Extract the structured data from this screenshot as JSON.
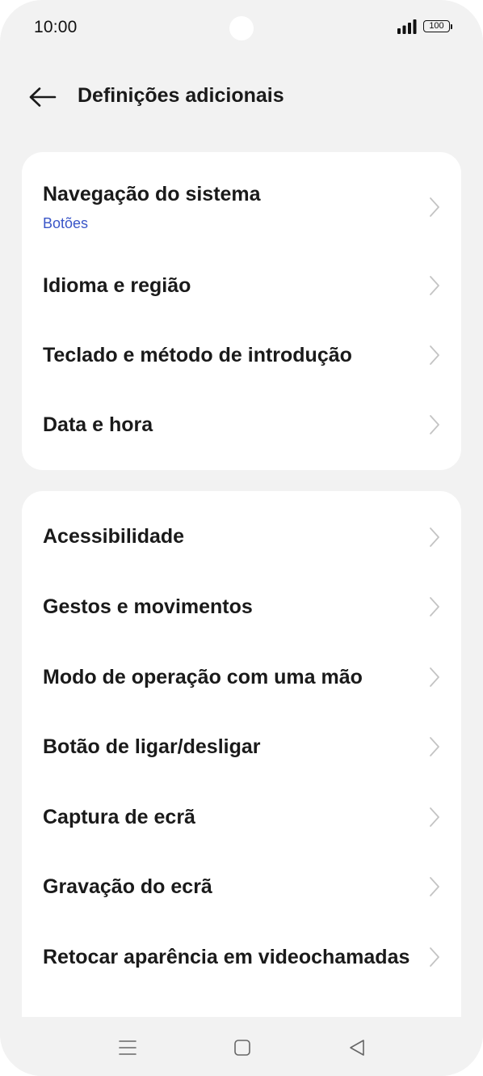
{
  "status_bar": {
    "time": "10:00",
    "battery": "100",
    "icons": [
      "signal-icon",
      "battery-icon"
    ]
  },
  "header": {
    "title": "Definições adicionais",
    "back_icon": "arrow-left-icon"
  },
  "group1": [
    {
      "label": "Navegação do sistema",
      "sub": "Botões"
    },
    {
      "label": "Idioma e região"
    },
    {
      "label": "Teclado e método de introdução"
    },
    {
      "label": "Data e hora"
    }
  ],
  "group2": [
    {
      "label": "Acessibilidade"
    },
    {
      "label": "Gestos e movimentos"
    },
    {
      "label": "Modo de operação com uma mão"
    },
    {
      "label": "Botão de ligar/desligar"
    },
    {
      "label": "Captura de ecrã"
    },
    {
      "label": "Gravação do ecrã"
    },
    {
      "label": "Retocar aparência em videochamadas"
    }
  ],
  "nav_bar": {
    "icons": [
      "menu-icon",
      "home-icon",
      "back-triangle-icon"
    ]
  },
  "colors": {
    "background": "#f2f2f2",
    "card": "#ffffff",
    "text": "#1a1a1a",
    "accent": "#3a56c8",
    "chevron": "#c4c4c4"
  }
}
